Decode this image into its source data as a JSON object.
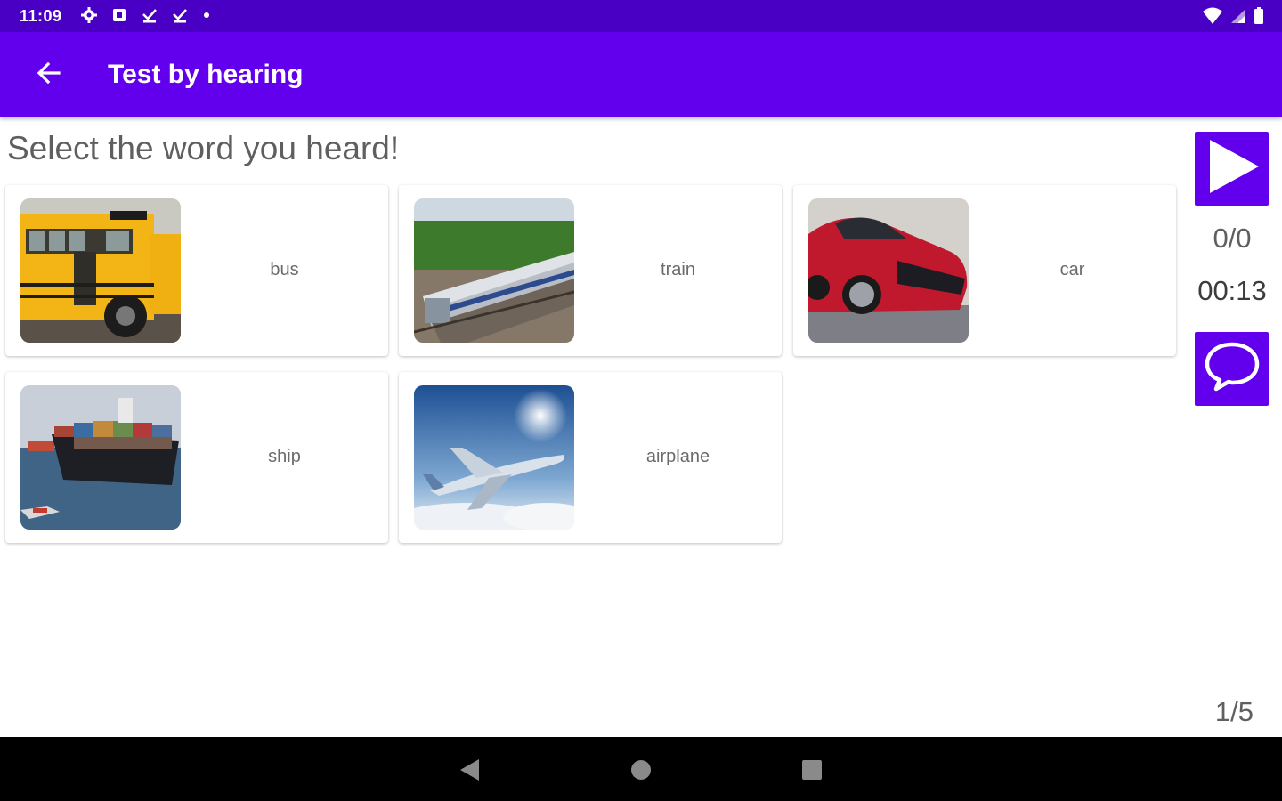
{
  "status_bar": {
    "time": "11:09",
    "left_icons": [
      "gear-icon",
      "app-notification-icon",
      "download-done-icon",
      "download-done-icon",
      "dot-icon"
    ],
    "right_icons": [
      "wifi-icon",
      "signal-icon",
      "battery-icon"
    ]
  },
  "app_bar": {
    "title": "Test by hearing",
    "back_icon": "arrow-back-icon",
    "background": "#6200ee"
  },
  "prompt": "Select the word you heard!",
  "options": [
    {
      "label": "bus",
      "image": "school-bus-photo"
    },
    {
      "label": "train",
      "image": "train-photo"
    },
    {
      "label": "car",
      "image": "red-car-photo"
    },
    {
      "label": "ship",
      "image": "container-ship-photo"
    },
    {
      "label": "airplane",
      "image": "airplane-photo"
    }
  ],
  "side_panel": {
    "play_icon": "play-icon",
    "score": "0/0",
    "timer": "00:13",
    "speak_icon": "speech-bubble-icon"
  },
  "progress": "1/5",
  "nav_bar": {
    "icons": [
      "back-triangle-icon",
      "home-circle-icon",
      "recents-square-icon"
    ]
  },
  "colors": {
    "status_bar": "#4a00c4",
    "accent": "#6200ee"
  }
}
